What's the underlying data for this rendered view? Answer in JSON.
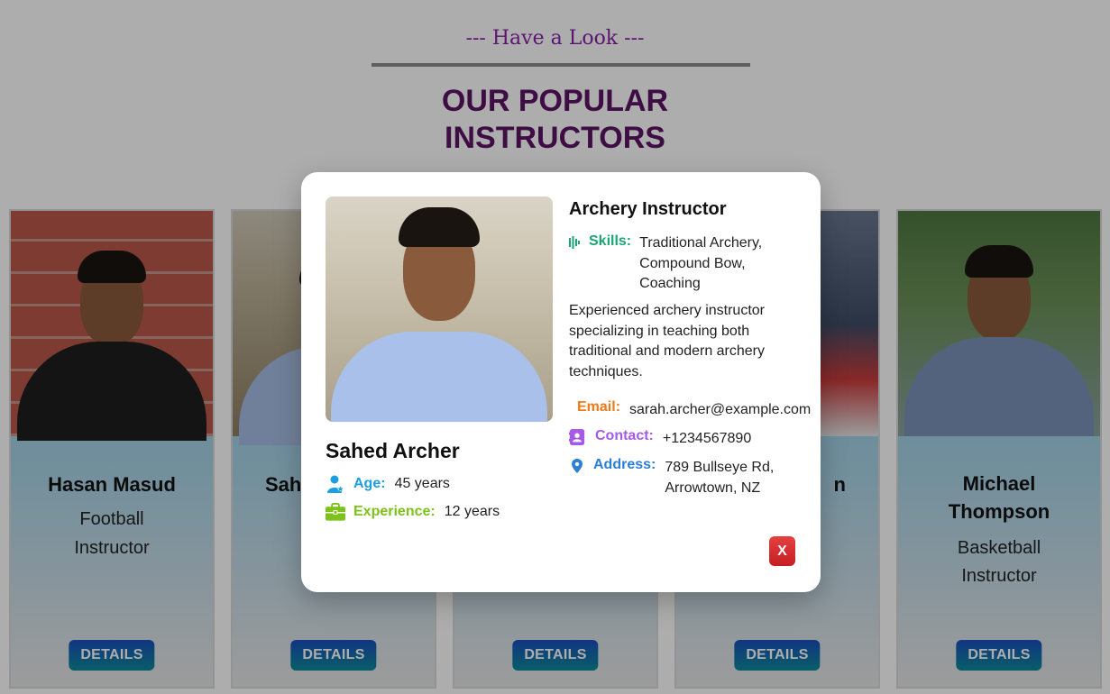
{
  "section": {
    "eyebrow": "--- Have a Look ---",
    "title_line1": "OUR POPULAR",
    "title_line2": "INSTRUCTORS"
  },
  "cards": [
    {
      "name": "Hasan Masud",
      "role_line1": "Football",
      "role_line2": "Instructor",
      "button": "DETAILS"
    },
    {
      "name": "Sah",
      "role_line1": "",
      "role_line2": "I",
      "button": "DETAILS"
    },
    {
      "name": "",
      "role_line1": "",
      "role_line2": "",
      "button": "DETAILS"
    },
    {
      "name": "n",
      "role_line1": "",
      "role_line2": "",
      "button": "DETAILS"
    },
    {
      "name_line1": "Michael",
      "name_line2": "Thompson",
      "role_line1": "Basketball",
      "role_line2": "Instructor",
      "button": "DETAILS"
    }
  ],
  "modal": {
    "name": "Sahed Archer",
    "age_label": "Age:",
    "age_value": "45 years",
    "experience_label": "Experience:",
    "experience_value": "12 years",
    "role": "Archery Instructor",
    "skills_label": "Skills:",
    "skills_value_line1": "Traditional Archery,",
    "skills_value_line2": "Compound Bow,",
    "skills_value_line3": "Coaching",
    "description_lines": [
      "Experienced archery instructor",
      "specializing in teaching both",
      "traditional and modern archery",
      "techniques."
    ],
    "email_label": "Email:",
    "email_value": "sarah.archer@example.com",
    "contact_label": "Contact:",
    "contact_value": "+1234567890",
    "address_label": "Address:",
    "address_line1": "789 Bullseye Rd,",
    "address_line2": "Arrowtown, NZ",
    "close_label": "X"
  },
  "colors": {
    "age": "#1a9fe0",
    "experience": "#7cc21a",
    "skills": "#1aa673",
    "email": "#f07a1a",
    "contact": "#a55be6",
    "address": "#2b7fd6",
    "title": "#5a1463",
    "eyebrow": "#8a1fa8"
  }
}
